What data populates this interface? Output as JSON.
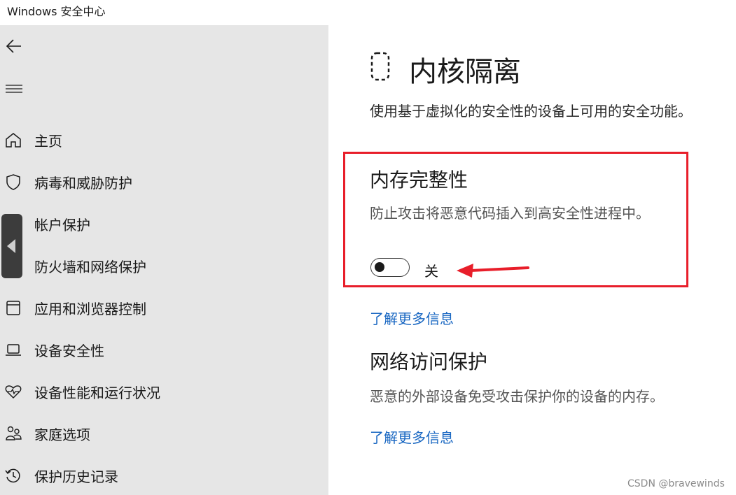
{
  "window": {
    "title": "Windows 安全中心"
  },
  "sidebar": {
    "items": [
      {
        "label": "主页",
        "icon": "home-icon"
      },
      {
        "label": "病毒和威胁防护",
        "icon": "shield-icon"
      },
      {
        "label": "帐户保护",
        "icon": "person-icon"
      },
      {
        "label": "防火墙和网络保护",
        "icon": "wifi-icon"
      },
      {
        "label": "应用和浏览器控制",
        "icon": "browser-window-icon"
      },
      {
        "label": "设备安全性",
        "icon": "laptop-icon"
      },
      {
        "label": "设备性能和运行状况",
        "icon": "heart-pulse-icon"
      },
      {
        "label": "家庭选项",
        "icon": "family-icon"
      },
      {
        "label": "保护历史记录",
        "icon": "history-icon"
      }
    ]
  },
  "main": {
    "title": "内核隔离",
    "description": "使用基于虚拟化的安全性的设备上可用的安全功能。",
    "memory_integrity": {
      "title": "内存完整性",
      "description": "防止攻击将恶意代码插入到高安全性进程中。",
      "toggle_state": "关",
      "toggle_on": false
    },
    "learn_more_1": "了解更多信息",
    "network_access": {
      "title": "网络访问保护",
      "description": "恶意的外部设备免受攻击保护你的设备的内存。"
    },
    "learn_more_2": "了解更多信息"
  },
  "annotation": {
    "highlight_color": "#e81e2a"
  },
  "watermark": "CSDN @bravewinds"
}
